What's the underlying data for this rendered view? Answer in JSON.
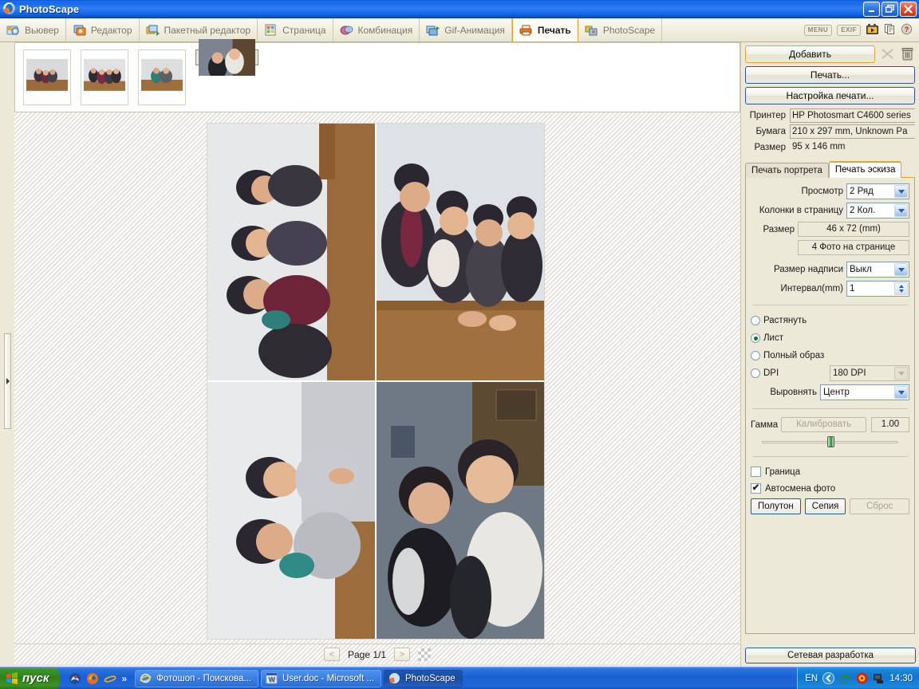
{
  "window": {
    "title": "PhotoScape",
    "app_icon": "photoscape-logo-icon",
    "minimize_label": "",
    "maximize_label": "",
    "close_label": "✕"
  },
  "menubar": {
    "tabs": [
      {
        "label": "Вьювер",
        "icon": "viewer-icon",
        "active": false
      },
      {
        "label": "Редактор",
        "icon": "editor-icon",
        "active": false
      },
      {
        "label": "Пакетный редактор",
        "icon": "batch-editor-icon",
        "active": false
      },
      {
        "label": "Страница",
        "icon": "page-icon",
        "active": false
      },
      {
        "label": "Комбинация",
        "icon": "combine-icon",
        "active": false
      },
      {
        "label": "Gif-Анимация",
        "icon": "gif-animation-icon",
        "active": false
      },
      {
        "label": "Печать",
        "icon": "print-icon",
        "active": true
      },
      {
        "label": "PhotoScape",
        "icon": "photoscape-icon",
        "active": false
      }
    ],
    "right_icons": [
      {
        "label": "MENU",
        "name": "menu-pill-icon"
      },
      {
        "label": "EXIF",
        "name": "exif-pill-icon"
      },
      {
        "label": "",
        "name": "slideshow-icon"
      },
      {
        "label": "",
        "name": "copy-icon"
      },
      {
        "label": "",
        "name": "help-icon"
      }
    ]
  },
  "thumbnails": [
    {
      "name": "thumbnail-1",
      "selected": false
    },
    {
      "name": "thumbnail-2",
      "selected": false
    },
    {
      "name": "thumbnail-3",
      "selected": false
    },
    {
      "name": "thumbnail-4",
      "selected": true
    }
  ],
  "pagebar": {
    "prev_label": "<",
    "next_label": ">",
    "page_label": "Page 1/1"
  },
  "panel": {
    "buttons": {
      "add": "Добавить",
      "print": "Печать...",
      "print_setup": "Настройка печати..."
    },
    "icon_buttons": [
      {
        "name": "shuffle-icon"
      },
      {
        "name": "trash-icon"
      }
    ],
    "info": [
      {
        "label": "Принтер",
        "value": "HP Photosmart C4600 series"
      },
      {
        "label": "Бумага",
        "value": "210 x 297 mm, Unknown Pa"
      },
      {
        "label": "Размер",
        "value": "95 x 146 mm"
      }
    ],
    "tabs": [
      {
        "label": "Печать портрета",
        "active": false
      },
      {
        "label": "Печать эскиза",
        "active": true
      }
    ],
    "fields": {
      "preview_label": "Просмотр",
      "preview_value": "2 Ряд",
      "columns_label": "Колонки в страницу",
      "columns_value": "2 Кол.",
      "size_label": "Размер",
      "size_value": "46 x 72 (mm)",
      "photos_per_page": "4 Фото на странице",
      "caption_size_label": "Размер надписи",
      "caption_size_value": "Выкл",
      "interval_label": "Интервал(mm)",
      "interval_value": "1"
    },
    "fit_options": [
      {
        "label": "Растянуть",
        "selected": false
      },
      {
        "label": "Лист",
        "selected": true
      },
      {
        "label": "Полный образ",
        "selected": false
      },
      {
        "label": "DPI",
        "selected": false
      }
    ],
    "dpi_value": "180 DPI",
    "align_label": "Выровнять",
    "align_value": "Центр",
    "gamma_label": "Гамма",
    "gamma_calibrate": "Калибровать",
    "gamma_value": "1.00",
    "checkboxes": [
      {
        "label": "Граница",
        "checked": false
      },
      {
        "label": "Автосмена фото",
        "checked": true
      }
    ],
    "tone_buttons": [
      {
        "label": "Полутон",
        "disabled": false
      },
      {
        "label": "Сепия",
        "disabled": false
      },
      {
        "label": "Сброс",
        "disabled": true
      }
    ],
    "network_button": "Сетевая разработка"
  },
  "taskbar": {
    "start_label": "пуск",
    "quicklaunch_overflow": "»",
    "items": [
      {
        "label": "Фотошоп - Поискова...",
        "icon": "ie-icon",
        "active": false
      },
      {
        "label": "User.doc - Microsoft ...",
        "icon": "word-icon",
        "active": false
      },
      {
        "label": "PhotoScape",
        "icon": "photoscape-logo-icon",
        "active": true
      }
    ],
    "tray": {
      "language": "EN",
      "clock": "14:30",
      "icons": [
        "show-hidden-icon",
        "at-icon",
        "antivirus-icon",
        "network-icon"
      ]
    }
  },
  "colors": {
    "accent": "#e0a33a",
    "titlebar": "#1868e8",
    "panel_bg": "#ece9d8",
    "button_border": "#34548c",
    "start_green": "#3d9428"
  }
}
